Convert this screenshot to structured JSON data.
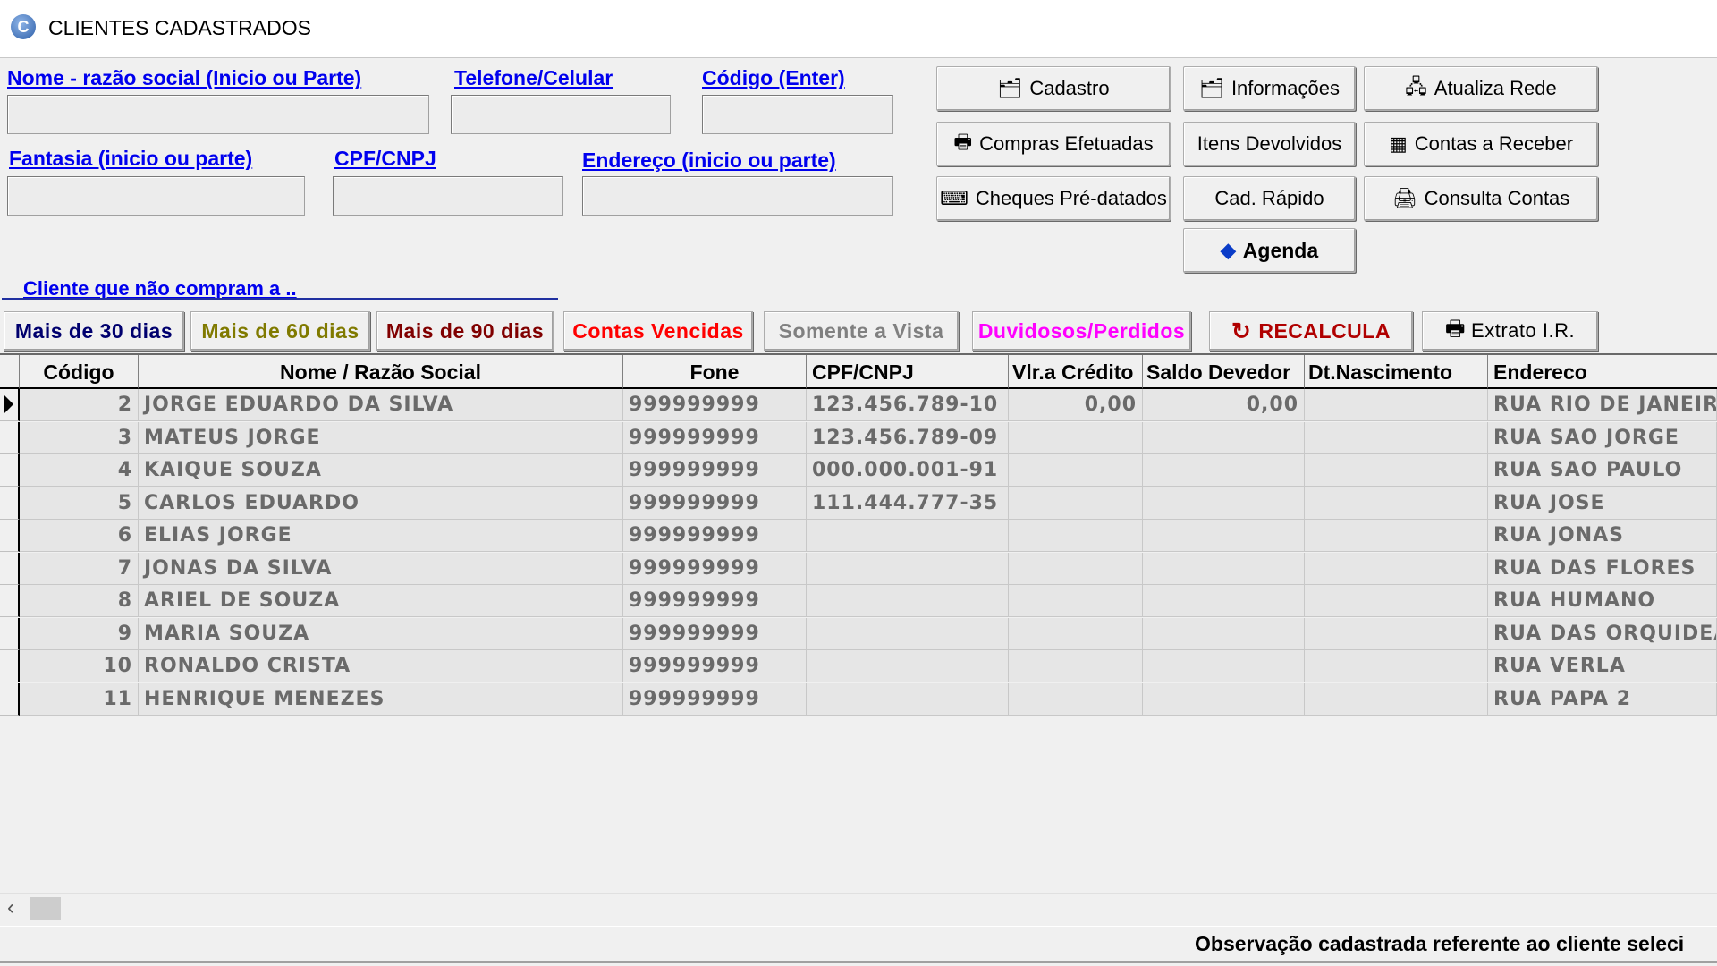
{
  "window": {
    "title": "CLIENTES CADASTRADOS",
    "icon": "app-logo-icon"
  },
  "search": {
    "nome_label": "Nome - razão social (Inicio ou Parte)",
    "telefone_label": "Telefone/Celular",
    "codigo_label": "Código (Enter)",
    "fantasia_label": "Fantasia (inicio ou parte)",
    "cpf_label": "CPF/CNPJ",
    "endereco_label": "Endereço (inicio ou parte)",
    "nome_value": "",
    "telefone_value": "",
    "codigo_value": "",
    "fantasia_value": "",
    "cpf_value": "",
    "endereco_value": ""
  },
  "actions": {
    "cadastro": "Cadastro",
    "informacoes": "Informações",
    "atualiza_rede": "Atualiza Rede",
    "compras": "Compras Efetuadas",
    "itens_devolvidos": "Itens Devolvidos",
    "contas_receber": "Contas a Receber",
    "cheques": "Cheques Pré-datados",
    "cad_rapido": "Cad. Rápido",
    "consulta_contas": "Consulta Contas",
    "agenda": "Agenda"
  },
  "filters": {
    "section_label": "Cliente que não compram a ..",
    "mais30": "Mais de 30 dias",
    "mais60": "Mais de 60 dias",
    "mais90": "Mais de 90 dias",
    "vencidas": "Contas Vencidas",
    "vista": "Somente a Vista",
    "duvidosos": "Duvidosos/Perdidos",
    "recalcula": "RECALCULA",
    "extrato": "Extrato I.R."
  },
  "colors": {
    "mais30": "#00006e",
    "mais60": "#807a00",
    "mais90": "#800000",
    "vencidas": "#ff0000",
    "vista": "#808080",
    "duvidosos": "#ff00ff",
    "recalcula": "#b00000",
    "link": "#0000ee"
  },
  "grid": {
    "headers": {
      "codigo": "Código",
      "nome": "Nome / Razão Social",
      "fone": "Fone",
      "cpf": "CPF/CNPJ",
      "credito": "Vlr.a Crédito",
      "saldo": "Saldo Devedor",
      "nascimento": "Dt.Nascimento",
      "endereco": "Endereco"
    },
    "rows": [
      {
        "codigo": "2",
        "nome": "JORGE EDUARDO DA SILVA",
        "fone": "999999999",
        "cpf": "123.456.789-10",
        "credito": "0,00",
        "saldo": "0,00",
        "nascimento": "",
        "endereco": " RUA RIO DE JANEIR"
      },
      {
        "codigo": "3",
        "nome": "MATEUS JORGE",
        "fone": "999999999",
        "cpf": "123.456.789-09",
        "credito": "",
        "saldo": "",
        "nascimento": "",
        "endereco": "RUA SAO JORGE"
      },
      {
        "codigo": "4",
        "nome": "KAIQUE SOUZA",
        "fone": "999999999",
        "cpf": "000.000.001-91",
        "credito": "",
        "saldo": "",
        "nascimento": "",
        "endereco": "RUA SAO PAULO"
      },
      {
        "codigo": "5",
        "nome": "CARLOS EDUARDO",
        "fone": "999999999",
        "cpf": "111.444.777-35",
        "credito": "",
        "saldo": "",
        "nascimento": "",
        "endereco": "RUA JOSE"
      },
      {
        "codigo": "6",
        "nome": "ELIAS JORGE",
        "fone": "999999999",
        "cpf": "",
        "credito": "",
        "saldo": "",
        "nascimento": "",
        "endereco": "RUA JONAS"
      },
      {
        "codigo": "7",
        "nome": "JONAS DA SILVA",
        "fone": "999999999",
        "cpf": "",
        "credito": "",
        "saldo": "",
        "nascimento": "",
        "endereco": "RUA DAS FLORES"
      },
      {
        "codigo": "8",
        "nome": "ARIEL DE SOUZA",
        "fone": "999999999",
        "cpf": "",
        "credito": "",
        "saldo": "",
        "nascimento": "",
        "endereco": "RUA HUMANO"
      },
      {
        "codigo": "9",
        "nome": "MARIA SOUZA",
        "fone": "999999999",
        "cpf": "",
        "credito": "",
        "saldo": "",
        "nascimento": "",
        "endereco": "RUA DAS ORQUIDEA"
      },
      {
        "codigo": "10",
        "nome": "RONALDO CRISTA",
        "fone": "999999999",
        "cpf": "",
        "credito": "",
        "saldo": "",
        "nascimento": "",
        "endereco": "RUA VERLA"
      },
      {
        "codigo": "11",
        "nome": "HENRIQUE MENEZES",
        "fone": "999999999",
        "cpf": "",
        "credito": "",
        "saldo": "",
        "nascimento": "",
        "endereco": "RUA PAPA 2"
      }
    ]
  },
  "footer": {
    "observacao": "Observação cadastrada referente ao cliente seleci"
  }
}
